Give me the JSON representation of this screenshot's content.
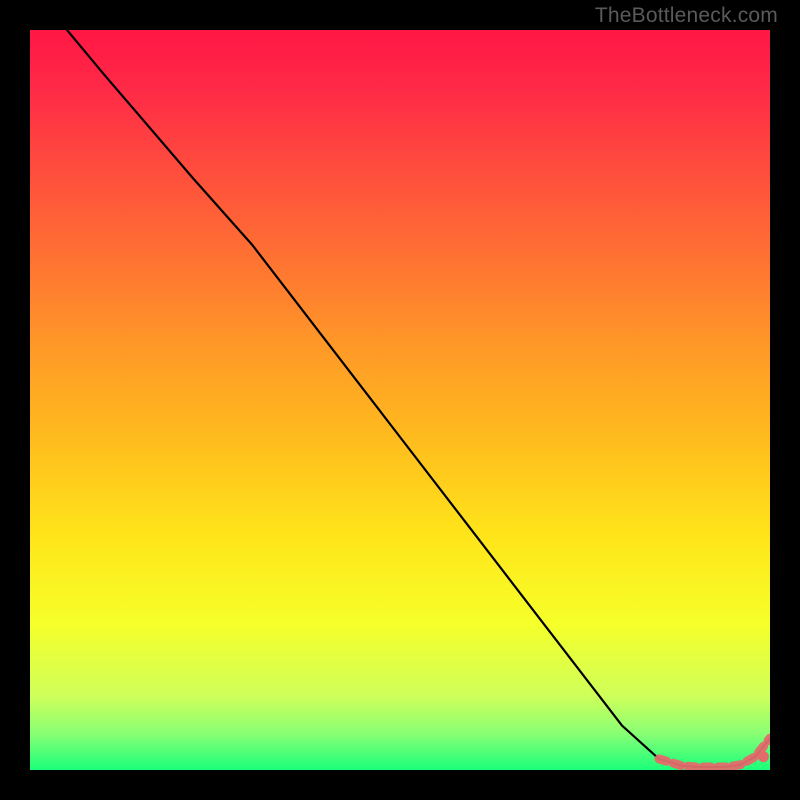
{
  "watermark": {
    "text": "TheBottleneck.com"
  },
  "gradient": {
    "stops": [
      {
        "offset": 0.0,
        "color": "#ff1744"
      },
      {
        "offset": 0.08,
        "color": "#ff2a47"
      },
      {
        "offset": 0.18,
        "color": "#ff4a3e"
      },
      {
        "offset": 0.3,
        "color": "#ff6f33"
      },
      {
        "offset": 0.42,
        "color": "#ff9628"
      },
      {
        "offset": 0.55,
        "color": "#ffbb1e"
      },
      {
        "offset": 0.68,
        "color": "#ffe41a"
      },
      {
        "offset": 0.8,
        "color": "#f6ff29"
      },
      {
        "offset": 0.9,
        "color": "#cfff59"
      },
      {
        "offset": 0.95,
        "color": "#8aff74"
      },
      {
        "offset": 1.0,
        "color": "#1aff7a"
      }
    ]
  },
  "colors": {
    "line": "#000000",
    "marker_fill": "#e36b6b",
    "marker_stroke": "#e36b6b"
  },
  "chart_data": {
    "type": "line",
    "title": "",
    "xlabel": "",
    "ylabel": "",
    "xlim": [
      0,
      100
    ],
    "ylim": [
      0,
      100
    ],
    "grid": false,
    "legend": false,
    "series": [
      {
        "name": "curve",
        "x": [
          0,
          10,
          22,
          30,
          40,
          50,
          60,
          70,
          80,
          85,
          88,
          90,
          92,
          94,
          96,
          98,
          100
        ],
        "y": [
          106,
          94,
          80,
          71,
          58,
          45,
          32,
          19,
          6,
          1.5,
          0.6,
          0.4,
          0.4,
          0.4,
          0.7,
          1.8,
          4.3
        ]
      }
    ],
    "markers": {
      "series": "curve",
      "from_index": 9,
      "to_index": 16
    }
  }
}
